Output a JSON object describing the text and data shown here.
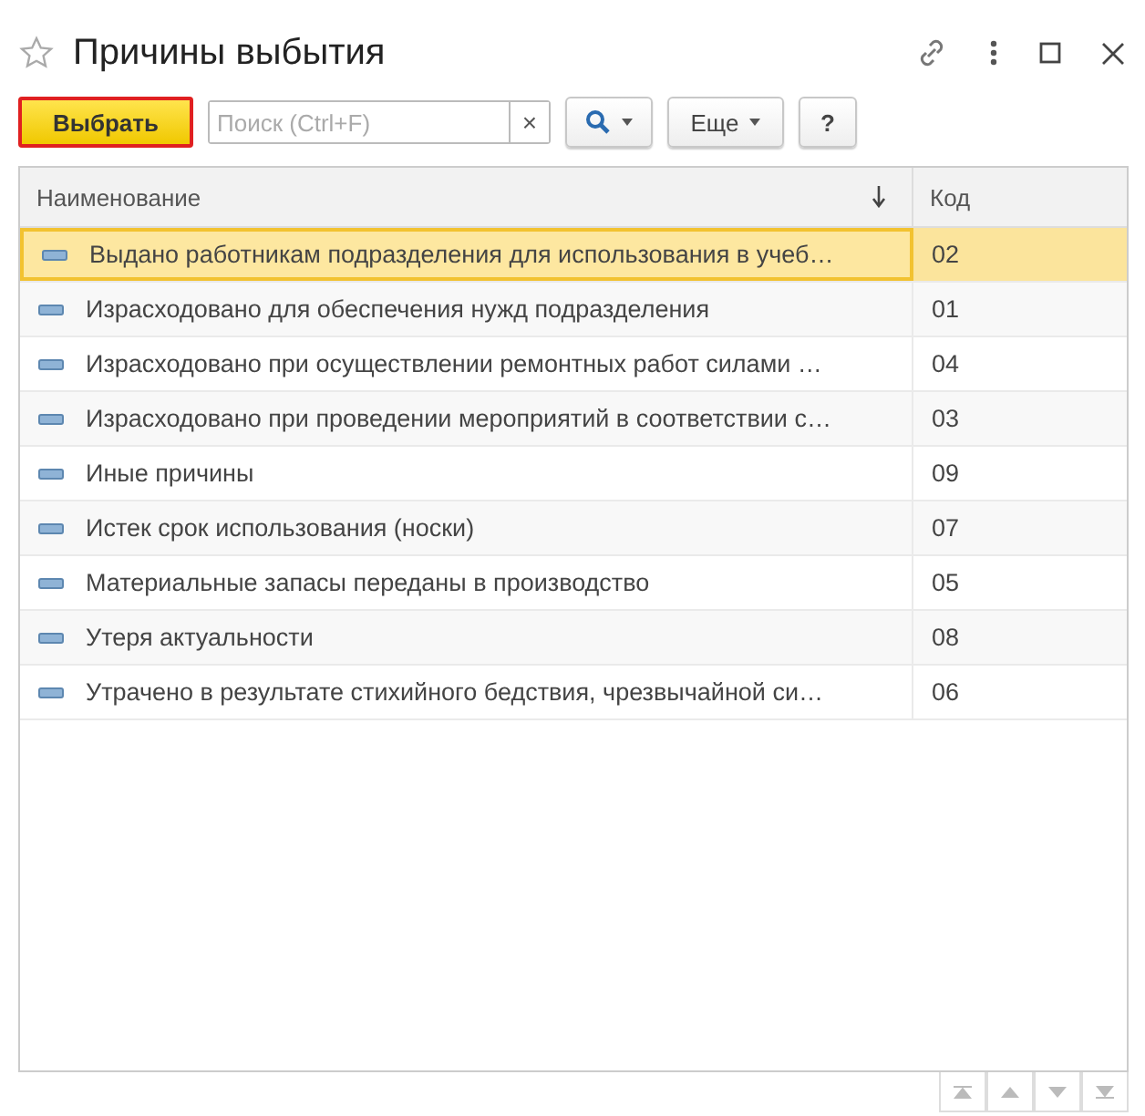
{
  "window": {
    "title": "Причины выбытия"
  },
  "toolbar": {
    "select_button": "Выбрать",
    "search": {
      "placeholder": "Поиск (Ctrl+F)",
      "clear": "×"
    },
    "more_button": "Еще",
    "help_button": "?"
  },
  "table": {
    "columns": [
      "Наименование",
      "Код"
    ],
    "rows": [
      {
        "name": "Выдано работникам подразделения для использования в учеб…",
        "code": "02",
        "selected": true
      },
      {
        "name": "Израсходовано для обеспечения нужд подразделения",
        "code": "01",
        "selected": false
      },
      {
        "name": "Израсходовано при осуществлении ремонтных работ силами …",
        "code": "04",
        "selected": false
      },
      {
        "name": "Израсходовано при проведении мероприятий в соответствии с…",
        "code": "03",
        "selected": false
      },
      {
        "name": "Иные причины",
        "code": "09",
        "selected": false
      },
      {
        "name": "Истек срок использования (носки)",
        "code": "07",
        "selected": false
      },
      {
        "name": "Материальные запасы переданы в производство",
        "code": "05",
        "selected": false
      },
      {
        "name": "Утеря актуальности",
        "code": "08",
        "selected": false
      },
      {
        "name": "Утрачено в результате стихийного бедствия, чрезвычайной си…",
        "code": "06",
        "selected": false
      }
    ]
  }
}
